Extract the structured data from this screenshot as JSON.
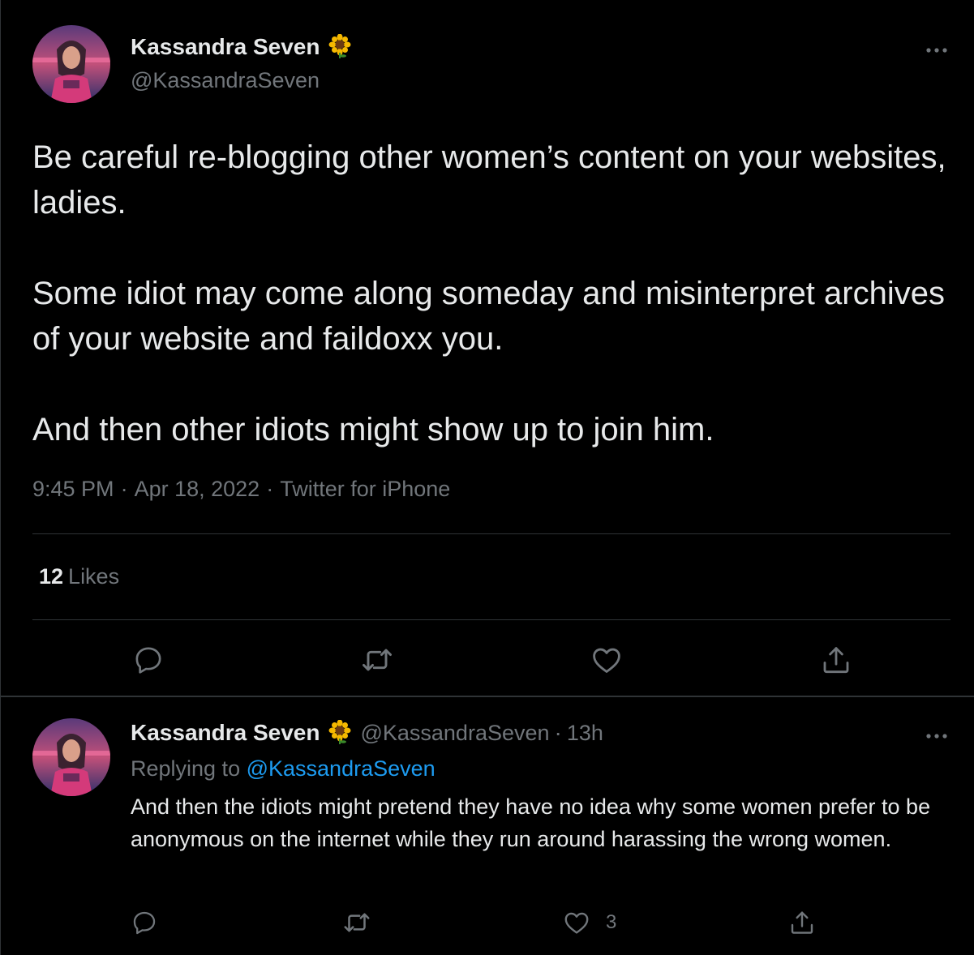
{
  "colors": {
    "background": "#000000",
    "text_primary": "#e7e9ea",
    "text_secondary": "#71767b",
    "link": "#1d9bf0",
    "divider": "#2f3336"
  },
  "tweet": {
    "author": {
      "name": "Kassandra Seven",
      "emoji": "sunflower",
      "handle": "@KassandraSeven",
      "avatar_icon": "avatar-image"
    },
    "more_icon": "more-icon",
    "text": {
      "p1": "Be careful re-blogging other women’s content on your websites, ladies.",
      "p2": "Some idiot may come along someday and misinterpret archives of your website and faildoxx you.",
      "p3": "And then other idiots might show up to join him."
    },
    "meta": {
      "time": "9:45 PM",
      "sep1": "·",
      "date": "Apr 18, 2022",
      "sep2": "·",
      "source": "Twitter for iPhone"
    },
    "likes": {
      "count": "12",
      "label": "Likes"
    },
    "actions": [
      "reply-icon",
      "retweet-icon",
      "like-icon",
      "share-icon"
    ]
  },
  "reply": {
    "author": {
      "name": "Kassandra Seven",
      "emoji": "sunflower",
      "handle": "@KassandraSeven",
      "dot": "·",
      "time": "13h"
    },
    "replying_to": {
      "prefix": "Replying to",
      "mention": "@KassandraSeven"
    },
    "text": "And then the idiots might pretend they have no idea why some women prefer to be anonymous on the internet while they run around harassing the wrong women.",
    "like_count": "3",
    "actions": [
      "reply-icon",
      "retweet-icon",
      "like-icon",
      "share-icon"
    ]
  }
}
